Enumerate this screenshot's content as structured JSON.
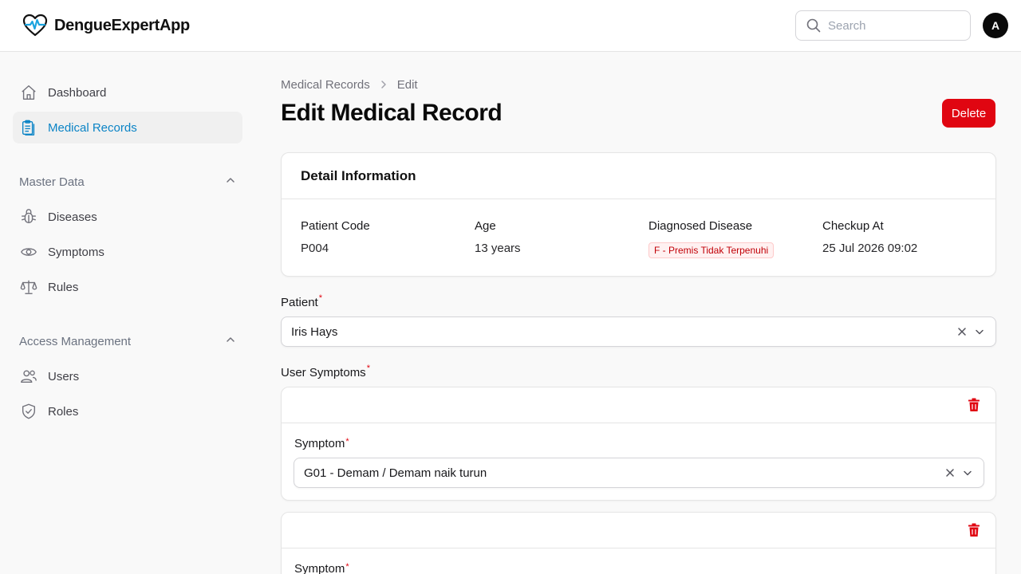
{
  "app": {
    "name": "DengueExpertApp"
  },
  "header": {
    "search_placeholder": "Search",
    "avatar_initial": "A"
  },
  "sidebar": {
    "items": [
      {
        "label": "Dashboard",
        "icon": "home-icon"
      },
      {
        "label": "Medical Records",
        "icon": "clipboard-icon",
        "active": true
      }
    ],
    "groups": [
      {
        "title": "Master Data",
        "items": [
          {
            "label": "Diseases",
            "icon": "bug-icon"
          },
          {
            "label": "Symptoms",
            "icon": "eye-icon"
          },
          {
            "label": "Rules",
            "icon": "scale-icon"
          }
        ]
      },
      {
        "title": "Access Management",
        "items": [
          {
            "label": "Users",
            "icon": "users-icon"
          },
          {
            "label": "Roles",
            "icon": "shield-check-icon"
          }
        ]
      }
    ]
  },
  "breadcrumb": {
    "parent": "Medical Records",
    "current": "Edit"
  },
  "page": {
    "title": "Edit Medical Record",
    "delete_label": "Delete"
  },
  "detail": {
    "heading": "Detail Information",
    "patient_code_label": "Patient Code",
    "patient_code": "P004",
    "age_label": "Age",
    "age": "13 years",
    "disease_label": "Diagnosed Disease",
    "disease": "F - Premis Tidak Terpenuhi",
    "checkup_label": "Checkup At",
    "checkup": "25 Jul 2026 09:02"
  },
  "form": {
    "patient_label": "Patient",
    "patient_value": "Iris Hays",
    "symptoms_label": "User Symptoms",
    "symptom_field_label": "Symptom",
    "symptoms": [
      {
        "value": "G01 - Demam / Demam naik turun"
      },
      {
        "value": ""
      }
    ]
  },
  "colors": {
    "accent": "#0b84c6",
    "danger": "#e00611",
    "badge_text": "#c10007",
    "badge_bg": "#fff1f1"
  }
}
